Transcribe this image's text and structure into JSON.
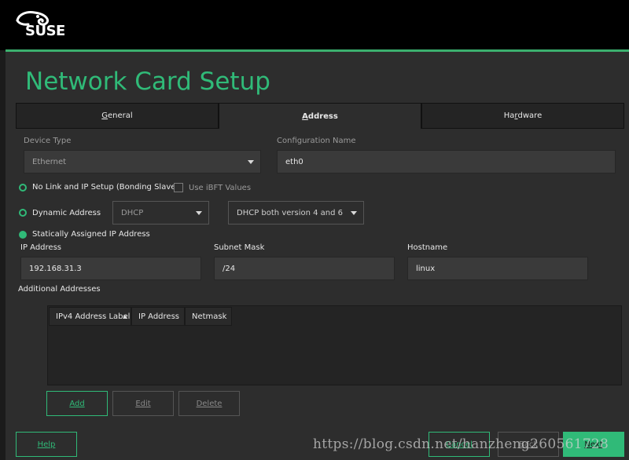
{
  "brand": {
    "logo_text": "SUSE"
  },
  "page": {
    "title": "Network Card Setup"
  },
  "tabs": [
    {
      "label_pre": "",
      "label_u": "G",
      "label_post": "eneral"
    },
    {
      "label_pre": "",
      "label_u": "A",
      "label_post": "ddress"
    },
    {
      "label_pre": "Ha",
      "label_u": "r",
      "label_post": "dware"
    }
  ],
  "device_type": {
    "label": "Device Type",
    "value": "Ethernet"
  },
  "config_name": {
    "label": "Configuration Name",
    "value": "eth0"
  },
  "options": {
    "no_link": {
      "label": "No Link and IP Setup (Bonding Slaves)",
      "selected": false
    },
    "use_ibft": {
      "label": "Use iBFT Values",
      "checked": false
    },
    "dynamic": {
      "label": "Dynamic Address",
      "selected": false,
      "mode": "DHCP",
      "version": "DHCP both version 4 and 6"
    },
    "static": {
      "label": "Statically Assigned IP Address",
      "selected": true
    }
  },
  "ip_address": {
    "label": "IP Address",
    "value": "192.168.31.3"
  },
  "subnet_mask": {
    "label": "Subnet Mask",
    "value": "/24"
  },
  "hostname": {
    "label": "Hostname",
    "value": "linux"
  },
  "additional": {
    "label": "Additional Addresses",
    "columns": [
      "IPv4 Address Label",
      "IP Address",
      "Netmask"
    ],
    "rows": []
  },
  "table_buttons": {
    "add": "Add",
    "edit": "Edit",
    "delete": "Delete"
  },
  "footer": {
    "help": "Help",
    "cancel": "Cancel",
    "back": "Back",
    "next": "Next"
  },
  "watermark": "https://blog.csdn.net/hanzheng260561728",
  "colors": {
    "accent": "#30ba78",
    "background": "#2d2d2d",
    "topbar": "#000000"
  }
}
